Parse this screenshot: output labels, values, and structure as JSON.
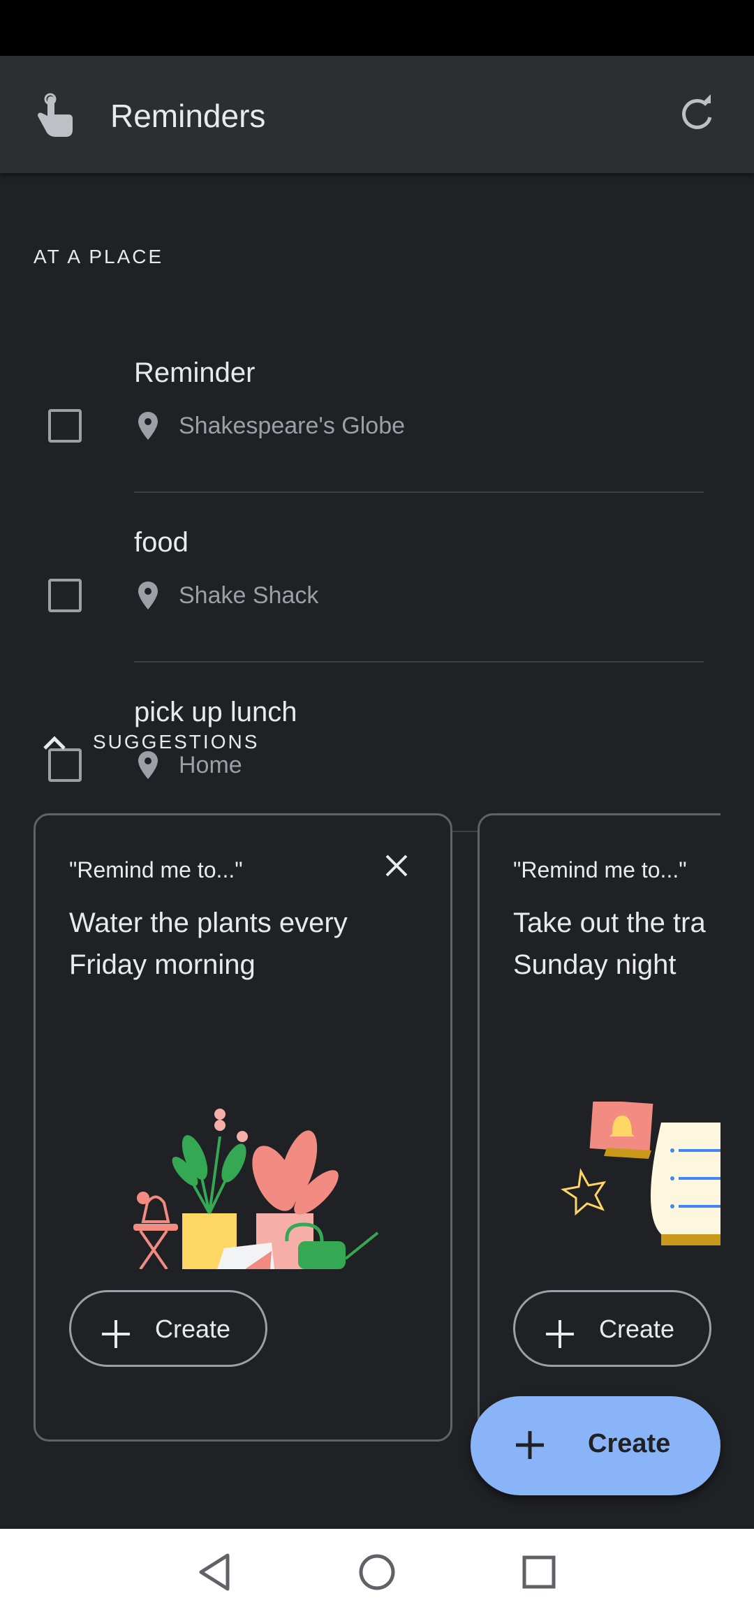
{
  "app": {
    "title": "Reminders",
    "icon": "touch-hand-icon",
    "refresh_icon": "refresh-icon"
  },
  "at_place": {
    "header": "AT A PLACE",
    "items": [
      {
        "title": "Reminder",
        "place": "Shakespeare's Globe",
        "checked": false
      },
      {
        "title": "food",
        "place": "Shake Shack",
        "checked": false
      },
      {
        "title": "pick up lunch",
        "place": "Home",
        "checked": false
      }
    ]
  },
  "suggestions": {
    "header": "SUGGESTIONS",
    "cards": [
      {
        "label": "\"Remind me to...\"",
        "line1": "Water the plants every",
        "line2": "Friday morning",
        "create_label": "Create"
      },
      {
        "label": "\"Remind me to...\"",
        "line1": "Take out the tra",
        "line2": "Sunday night",
        "create_label": "Create"
      }
    ]
  },
  "fab": {
    "label": "Create"
  },
  "colors": {
    "background": "#202124",
    "appbar": "#2d2e31",
    "accent": "#8ab4f8"
  }
}
